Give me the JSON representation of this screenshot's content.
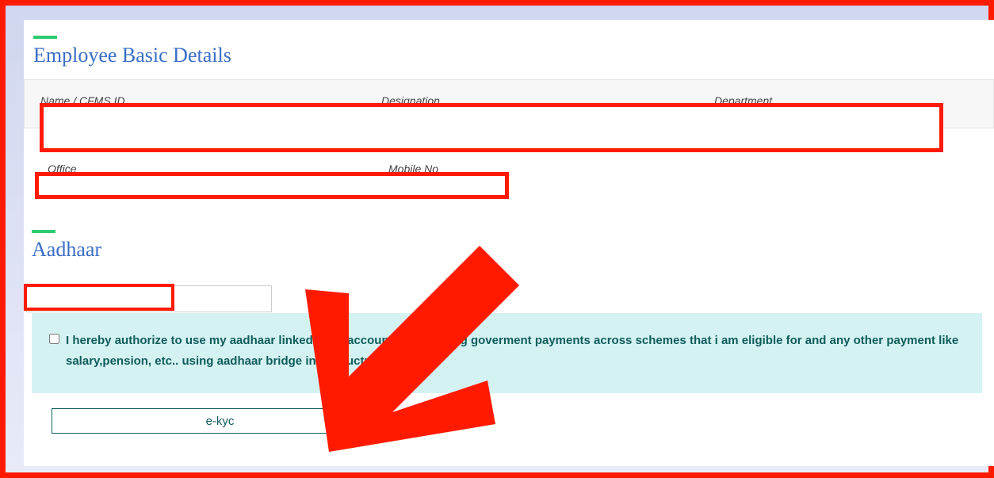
{
  "sections": {
    "employee_title": "Employee Basic Details",
    "aadhaar_title": "Aadhaar"
  },
  "fields": {
    "name_label": "Name / CFMS ID",
    "designation_label": "Designation",
    "department_label": "Department",
    "office_label": "Office",
    "mobile_label": "Mobile No"
  },
  "consent": {
    "text": "I hereby authorize to use my aadhaar linked bank account for receiving goverment payments across schemes that i am eligible for and any other payment like salary,pension, etc.. using aadhaar bridge infrastructure."
  },
  "buttons": {
    "ekyc_label": "e-kyc"
  },
  "aadhaar_input": {
    "value": ""
  }
}
